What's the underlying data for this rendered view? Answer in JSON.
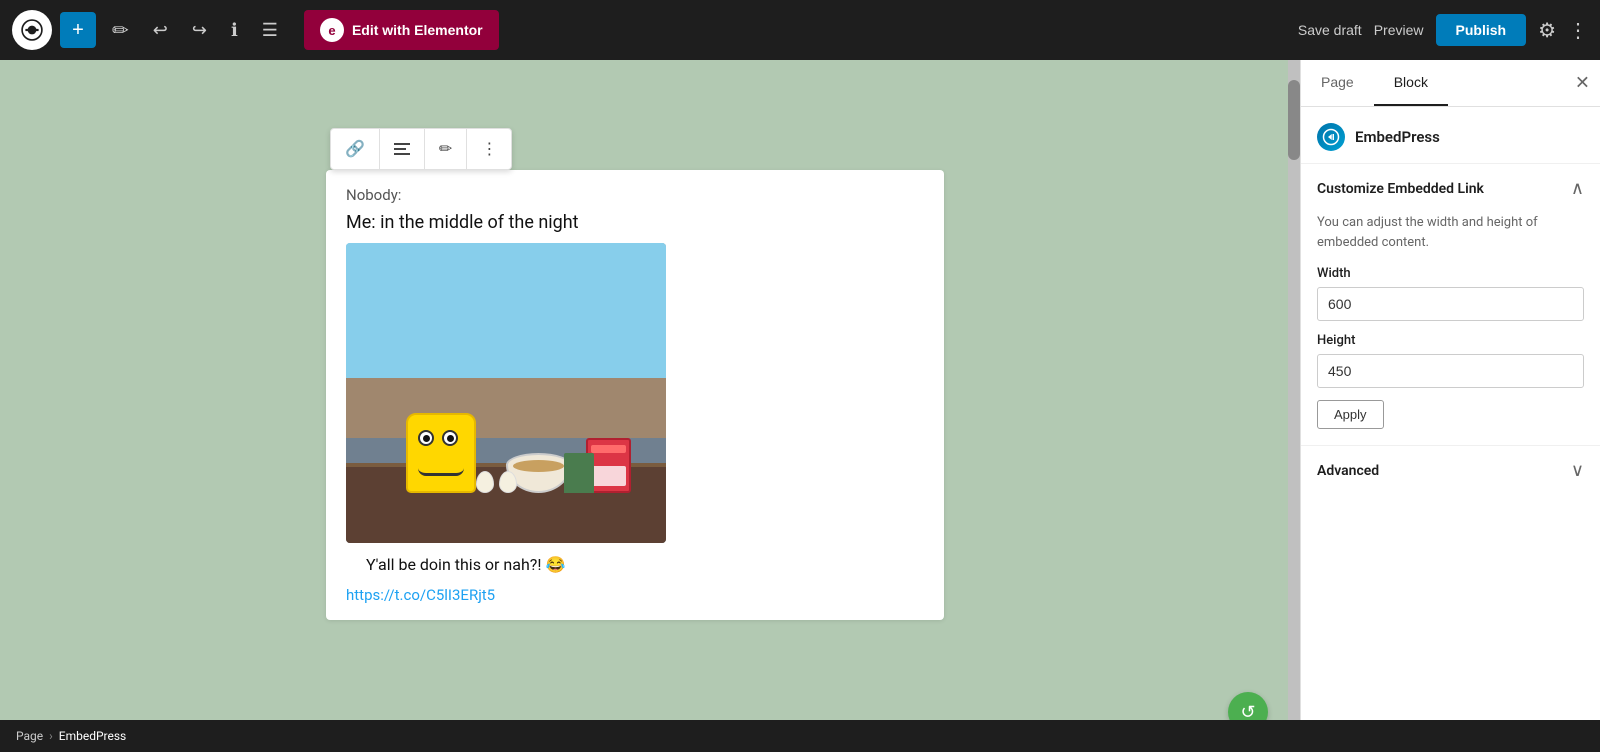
{
  "topbar": {
    "wp_logo": "W",
    "add_button_label": "+",
    "tools_icon": "✏",
    "undo_icon": "↩",
    "redo_icon": "↪",
    "info_icon": "ℹ",
    "list_icon": "☰",
    "edit_elementor_label": "Edit with Elementor",
    "elementor_icon": "e",
    "save_draft_label": "Save draft",
    "preview_label": "Preview",
    "publish_label": "Publish",
    "settings_icon": "⚙",
    "more_icon": "⋮"
  },
  "block_toolbar": {
    "link_icon": "🔗",
    "align_icon": "☰",
    "edit_icon": "✏",
    "more_icon": "⋮"
  },
  "embed": {
    "nobody_text": "Nobody:",
    "me_text": "Me: in the middle of the night",
    "caption": "Y'all be doin this or nah?! 😂",
    "link_text": "https://t.co/C5lI3ERjt5"
  },
  "right_panel": {
    "page_tab_label": "Page",
    "block_tab_label": "Block",
    "close_icon": "✕",
    "plugin_name": "EmbedPress",
    "plugin_icon_letter": "ep",
    "customize_section": {
      "title": "Customize Embedded Link",
      "toggle_icon": "∧",
      "description": "You can adjust the width and height of embedded content.",
      "width_label": "Width",
      "width_value": "600",
      "height_label": "Height",
      "height_value": "450",
      "apply_label": "Apply"
    },
    "advanced_section": {
      "title": "Advanced",
      "toggle_icon": "∨"
    }
  },
  "breadcrumb": {
    "page_label": "Page",
    "separator": "›",
    "embedpress_label": "EmbedPress"
  },
  "colors": {
    "topbar_bg": "#1e1e1e",
    "canvas_bg": "#b2c9b2",
    "panel_bg": "#ffffff",
    "publish_btn": "#007cba",
    "elementor_btn": "#92003b",
    "active_tab_border": "#1e1e1e"
  }
}
